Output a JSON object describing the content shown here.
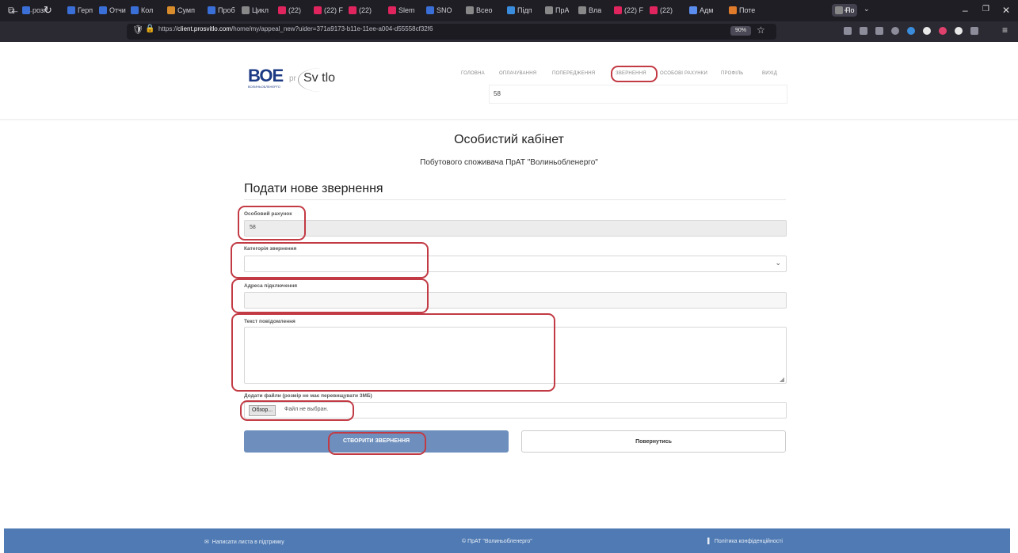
{
  "browser": {
    "tabs": [
      "розп",
      "Герп",
      "Отчи",
      "Кол",
      "Сумп",
      "Проб",
      "Цикл",
      "(22)",
      "(22) F",
      "(22)",
      "Slem",
      "SNO",
      "Всео",
      "Підп",
      "ПрА",
      "Вла",
      "(22) F",
      "(22)",
      "Адм",
      "Поте",
      "По"
    ],
    "new_tab": "+",
    "url_prefix": "https://",
    "url_host": "client.prosvitlo.com",
    "url_path": "/home/my/appeal_new?uider=371a9173-b11e-11ee-a004-d55558cf32f6",
    "zoom": "90%"
  },
  "site": {
    "logo_text": "ВОЕ",
    "logo_sub": "ВОЛИНЬОБЛЕНЕРГО",
    "brand_pr": "pr",
    "brand_svitlo": "Sv tlo",
    "menu": [
      "Головна",
      "Оплачування",
      "Попередження",
      "Звернення",
      "Особові рахунки",
      "Профіль",
      "Вихід"
    ],
    "account_top": "58"
  },
  "page": {
    "title": "Особистий кабінет",
    "subtitle": "Побутового споживача ПрАТ \"Волиньобленерго\""
  },
  "form": {
    "title": "Подати нове звернення",
    "account_label": "Особовий рахунок",
    "account_value": "58",
    "category_label": "Категорія звернення",
    "address_label": "Адреса підключення",
    "message_label": "Текст повідомлення",
    "file_label": "Додати файли (розмір не має перевищувати 3МБ)",
    "browse_button": "Обзор...",
    "file_status": "Файл не выбран.",
    "submit": "СТВОРИТИ ЗВЕРНЕННЯ",
    "back": "Повернутись"
  },
  "footer": {
    "support": "Написати листа в підтримку",
    "copyright": "© ПрАТ \"Волиньобленерго\"",
    "privacy": "Політика конфіденційності"
  },
  "colors": {
    "highlight": "#c23a44",
    "footer": "#4f7ab3",
    "submit_button": "#6e8fbd"
  }
}
